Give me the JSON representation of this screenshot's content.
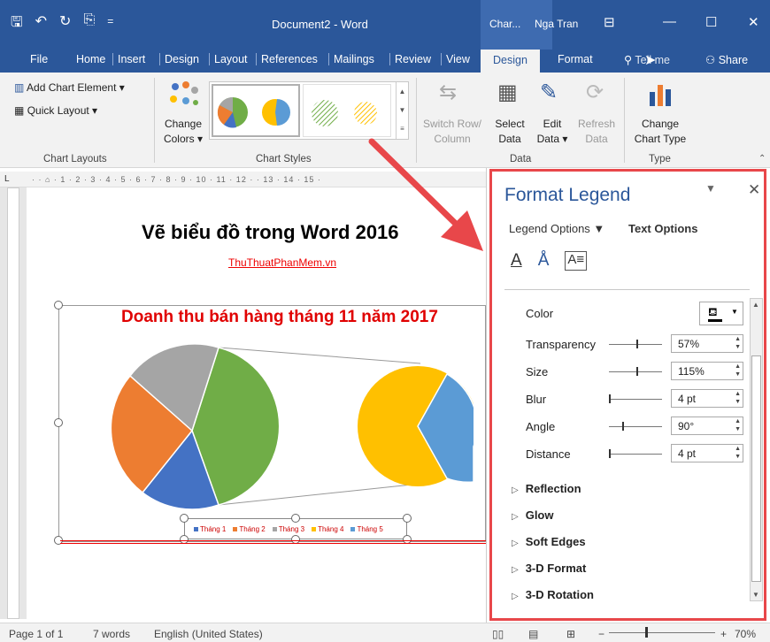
{
  "titlebar": {
    "doc_title": "Document2 - Word",
    "contextual": "Char...",
    "user": "Nga Tran",
    "qat": {
      "save": "🖫",
      "undo": "↶",
      "redo": "↻",
      "paste": "⎘",
      "customize": "="
    }
  },
  "tabs": {
    "file": "File",
    "home": "Home",
    "insert": "Insert",
    "design": "Design",
    "layout": "Layout",
    "references": "References",
    "mailings": "Mailings",
    "review": "Review",
    "view": "View",
    "chart_design": "Design",
    "format": "Format",
    "tellme": "Tell me",
    "share": "Share"
  },
  "ribbon": {
    "add_chart_element": "Add Chart Element ▾",
    "quick_layout": "Quick Layout ▾",
    "change_colors_1": "Change",
    "change_colors_2": "Colors ▾",
    "switch_row_1": "Switch Row/",
    "switch_row_2": "Column",
    "select_data_1": "Select",
    "select_data_2": "Data",
    "edit_data_1": "Edit",
    "edit_data_2": "Data ▾",
    "refresh_data_1": "Refresh",
    "refresh_data_2": "Data",
    "change_chart_type_1": "Change",
    "change_chart_type_2": "Chart Type",
    "groups": {
      "chart_layouts": "Chart Layouts",
      "chart_styles": "Chart Styles",
      "data": "Data",
      "type": "Type"
    }
  },
  "document": {
    "heading": "Vẽ biểu đồ trong Word 2016",
    "link": "ThuThuatPhanMem.vn",
    "chart_title": "Doanh thu bán hàng tháng 11 năm 2017",
    "legend": [
      {
        "label": "Tháng 1",
        "color": "#4472c4"
      },
      {
        "label": "Tháng 2",
        "color": "#ed7d31"
      },
      {
        "label": "Tháng 3",
        "color": "#a5a5a5"
      },
      {
        "label": "Tháng 4",
        "color": "#ffc000"
      },
      {
        "label": "Tháng 5",
        "color": "#5b9bd5"
      }
    ]
  },
  "pane": {
    "title": "Format Legend",
    "tab_legend_options": "Legend Options ▼",
    "tab_text_options": "Text Options",
    "rows": {
      "color": "Color",
      "transparency": "Transparency",
      "transparency_val": "57%",
      "size": "Size",
      "size_val": "115%",
      "blur": "Blur",
      "blur_val": "4 pt",
      "angle": "Angle",
      "angle_val": "90°",
      "distance": "Distance",
      "distance_val": "4 pt"
    },
    "sections": {
      "reflection": "Reflection",
      "glow": "Glow",
      "soft_edges": "Soft Edges",
      "format3d": "3-D Format",
      "rotation3d": "3-D Rotation"
    }
  },
  "status": {
    "page": "Page 1 of 1",
    "words": "7 words",
    "language": "English (United States)",
    "zoom": "70%"
  },
  "accent": "#2b579a",
  "highlight": "#e8474a"
}
